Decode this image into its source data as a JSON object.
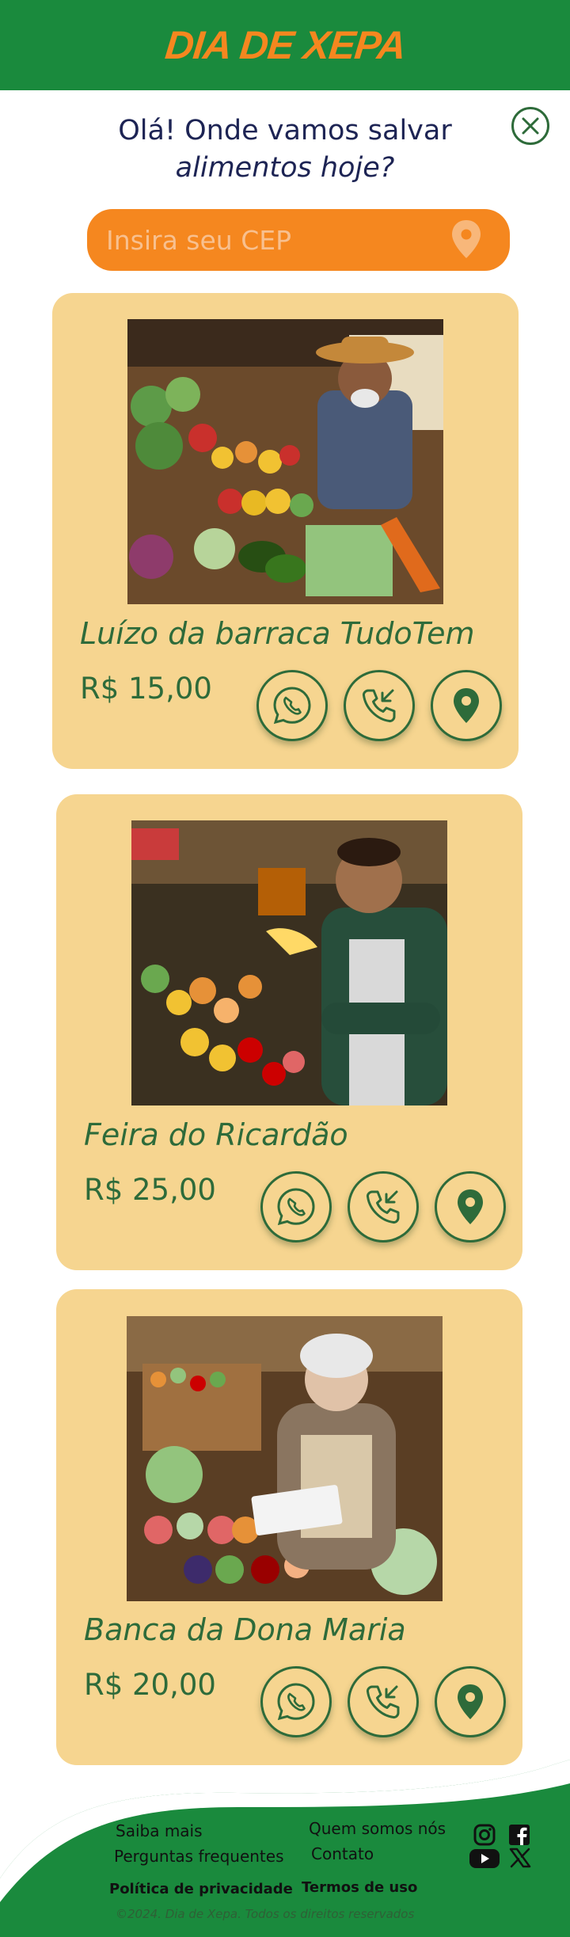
{
  "header": {
    "brand": "DIA DE XEPA"
  },
  "greeting": {
    "line1": "Olá! Onde vamos salvar",
    "line2": "alimentos hoje?"
  },
  "search": {
    "placeholder": "Insira seu CEP",
    "value": ""
  },
  "vendors": [
    {
      "name": "Luízo da barraca TudoTem",
      "price": "R$ 15,00"
    },
    {
      "name": "Feira do Ricardão",
      "price": "R$ 25,00"
    },
    {
      "name": "Banca da Dona Maria",
      "price": "R$ 20,00"
    }
  ],
  "footer": {
    "saiba_mais": "Saiba mais",
    "faq": "Perguntas frequentes",
    "quem_somos": "Quem somos nós",
    "contato": "Contato",
    "privacidade": "Política de privacidade",
    "termos": "Termos de uso",
    "copyright": "©2024. Dia de Xepa. Todos os direitos reservados"
  },
  "colors": {
    "green": "#1a8a3d",
    "orange": "#f5871f",
    "card": "#f6d590",
    "dark_green": "#2e6b3a"
  },
  "icons": [
    "close-icon",
    "location-pin-icon",
    "whatsapp-icon",
    "phone-callback-icon",
    "instagram-icon",
    "facebook-icon",
    "youtube-icon",
    "x-icon"
  ]
}
